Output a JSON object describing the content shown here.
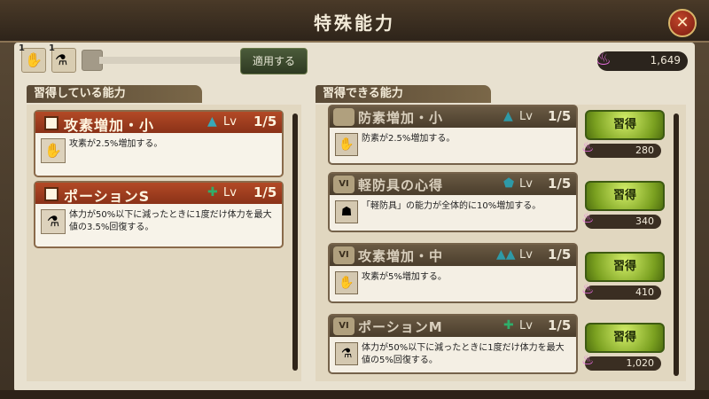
{
  "title": "特殊能力",
  "close_glyph": "✕",
  "topbar": {
    "slots": [
      {
        "count": "1",
        "icon": "hand-icon",
        "glyph": "✋"
      },
      {
        "count": "1",
        "icon": "potion-icon",
        "glyph": "⚗"
      },
      {
        "count": "",
        "icon": "empty-slot",
        "glyph": ""
      }
    ],
    "apply_label": "適用する",
    "currency_value": "1,649"
  },
  "learned": {
    "header": "習得している能力",
    "items": [
      {
        "name": "攻素増加・小",
        "lv_label": "Lv",
        "level": "1/5",
        "desc": "攻素が2.5%増加する。",
        "lv_icon": "triangle-icon",
        "lv_glyph": "▲",
        "thumb_glyph": "✋"
      },
      {
        "name": "ポーションS",
        "lv_label": "Lv",
        "level": "1/5",
        "desc": "体力が50%以下に減ったときに1度だけ体力を最大値の3.5%回復する。",
        "lv_icon": "cross-icon",
        "lv_glyph": "✚",
        "thumb_glyph": "⚗"
      }
    ]
  },
  "learnable": {
    "header": "習得できる能力",
    "items": [
      {
        "rank": "",
        "name": "防素増加・小",
        "lv_label": "Lv",
        "level": "1/5",
        "desc": "防素が2.5%増加する。",
        "lv_icon": "triangle-icon",
        "lv_glyph": "▲",
        "learn_label": "習得",
        "cost": "280",
        "thumb_glyph": "✋"
      },
      {
        "rank": "VI",
        "name": "軽防具の心得",
        "lv_label": "Lv",
        "level": "1/5",
        "desc": "「軽防具」の能力が全体的に10%増加する。",
        "lv_icon": "shield-icon",
        "lv_glyph": "⬟",
        "learn_label": "習得",
        "cost": "340",
        "thumb_glyph": "☗"
      },
      {
        "rank": "VI",
        "name": "攻素増加・中",
        "lv_label": "Lv",
        "level": "1/5",
        "desc": "攻素が5%増加する。",
        "lv_icon": "double-triangle-icon",
        "lv_glyph": "▲▲",
        "learn_label": "習得",
        "cost": "410",
        "thumb_glyph": "✋"
      },
      {
        "rank": "VI",
        "name": "ポーションM",
        "lv_label": "Lv",
        "level": "1/5",
        "desc": "体力が50%以下に減ったときに1度だけ体力を最大値の5%回復する。",
        "lv_icon": "cross-icon",
        "lv_glyph": "✚",
        "learn_label": "習得",
        "cost": "1,020",
        "thumb_glyph": "⚗"
      }
    ]
  },
  "colors": {
    "accent_green": "#7aa020",
    "header_red": "#b34a26",
    "currency_flame": "#e86de0"
  }
}
